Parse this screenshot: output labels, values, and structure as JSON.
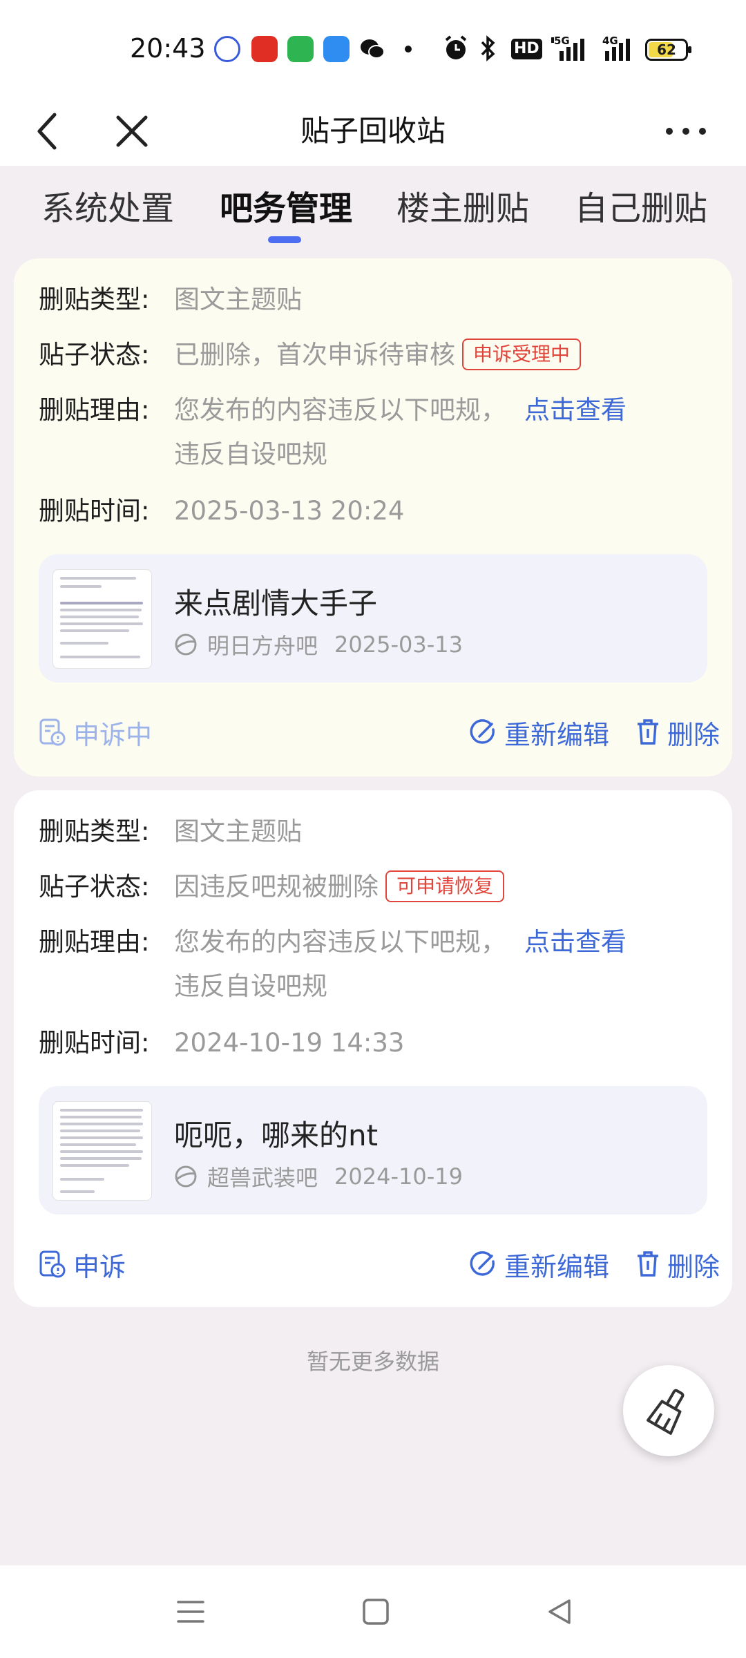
{
  "status_bar": {
    "time": "20:43",
    "app_icons": [
      "tieba-icon",
      "pinduoduo-icon",
      "shopping-icon",
      "files-icon",
      "wechat-icon"
    ],
    "network_4g": "4G",
    "network_5g": "5G",
    "hd_label": "HD",
    "battery": "62",
    "battery_level": 0.62
  },
  "nav": {
    "title": "贴子回收站"
  },
  "tabs": [
    {
      "label": "系统处置",
      "active": false
    },
    {
      "label": "吧务管理",
      "active": true
    },
    {
      "label": "楼主删贴",
      "active": false
    },
    {
      "label": "自己删贴",
      "active": false
    }
  ],
  "labels": {
    "type": "删贴类型:",
    "status": "贴子状态:",
    "reason": "删贴理由:",
    "time": "删贴时间:",
    "click_view": "点击查看",
    "re_edit": "重新编辑",
    "delete": "删除"
  },
  "cards": [
    {
      "type": "图文主题贴",
      "status": "已删除，首次申诉待审核",
      "badge": "申诉受理中",
      "reason_line1": "您发布的内容违反以下吧规，",
      "reason_line2": "违反自设吧规",
      "time": "2025-03-13 20:24",
      "post_title": "来点剧情大手子",
      "forum": "明日方舟吧",
      "post_date": "2025-03-13",
      "appeal_label": "申诉中"
    },
    {
      "type": "图文主题贴",
      "status": "因违反吧规被删除",
      "badge": "可申请恢复",
      "reason_line1": "您发布的内容违反以下吧规，",
      "reason_line2": "违反自设吧规",
      "time": "2024-10-19 14:33",
      "post_title": "呃呃，哪来的nt",
      "forum": "超兽武装吧",
      "post_date": "2024-10-19",
      "appeal_label": "申诉"
    }
  ],
  "footer": {
    "no_more": "暂无更多数据"
  },
  "colors": {
    "accent": "#4e6ef2",
    "link": "#3d68d8",
    "badge_red": "#e0443a",
    "page_bg": "#f2eef2",
    "card1_bg": "#fdfcf1"
  }
}
